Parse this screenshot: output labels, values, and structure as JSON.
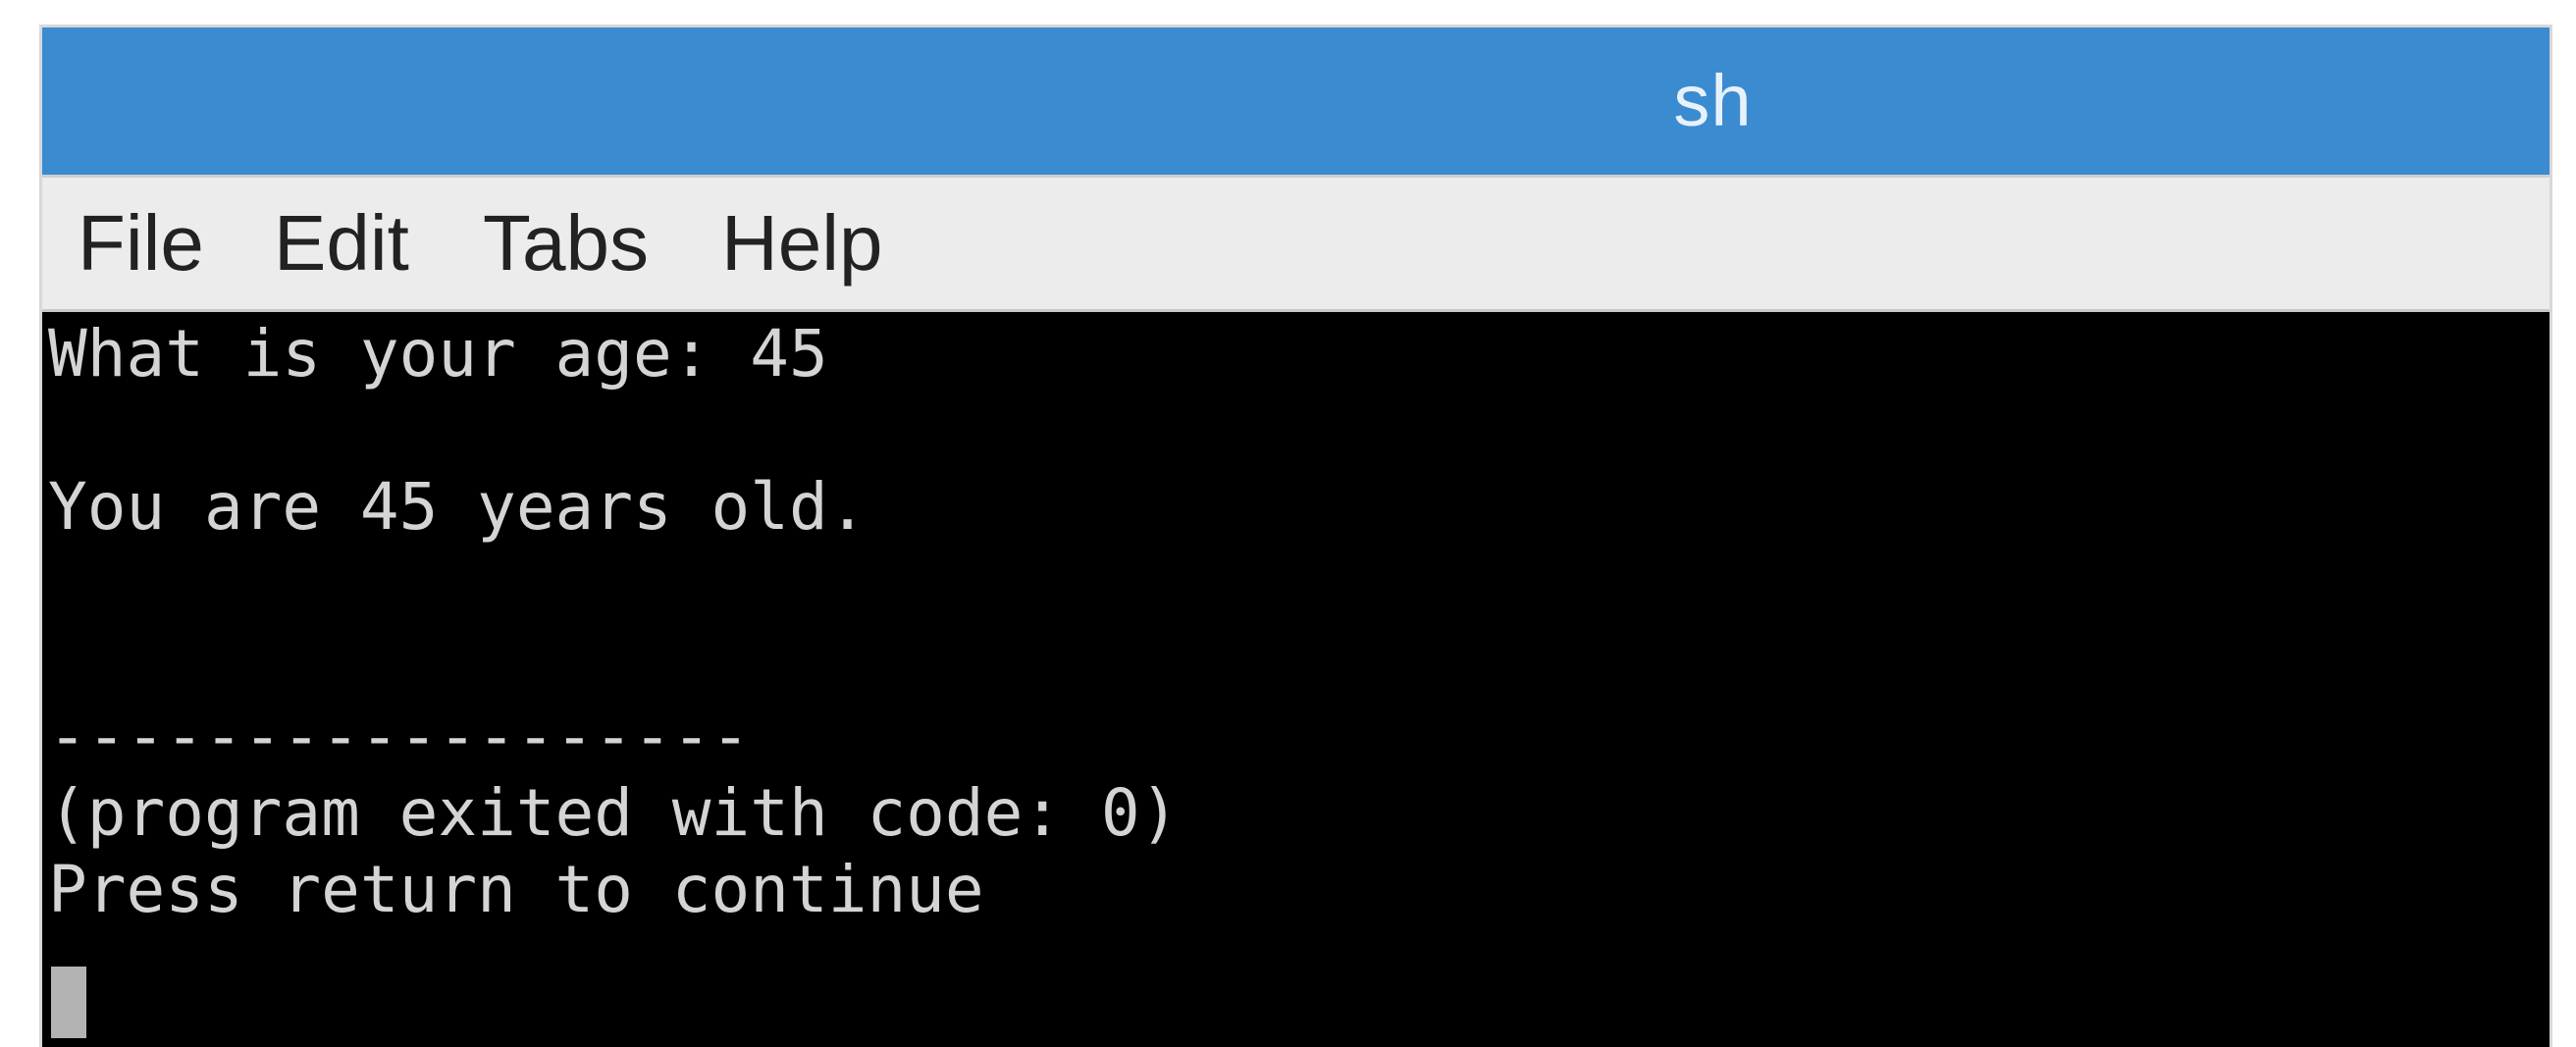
{
  "window": {
    "title": "sh"
  },
  "menubar": {
    "items": [
      "File",
      "Edit",
      "Tabs",
      "Help"
    ]
  },
  "terminal": {
    "lines": [
      "What is your age: 45",
      "",
      "You are 45 years old.",
      "",
      "",
      "------------------",
      "(program exited with code: 0)",
      "Press return to continue"
    ]
  },
  "colors": {
    "titlebar": "#3b8bd0",
    "menubar": "#ececec",
    "terminal_bg": "#000000",
    "terminal_fg": "#d4d4d4"
  }
}
